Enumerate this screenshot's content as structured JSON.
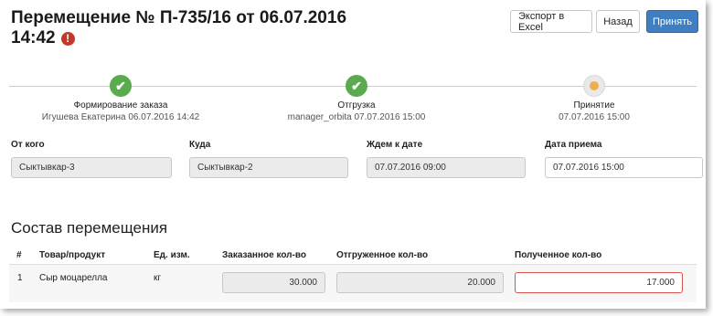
{
  "header": {
    "title_line1": "Перемещение № П-735/16 от 06.07.2016",
    "title_line2": "14:42",
    "warning_glyph": "!"
  },
  "toolbar": {
    "export_label": "Экспорт в Excel",
    "back_label": "Назад",
    "accept_label": "Принять"
  },
  "steps": [
    {
      "label": "Формирование заказа",
      "sub": "Игушева Екатерина 06.07.2016 14:42",
      "status": "done"
    },
    {
      "label": "Отгрузка",
      "sub": "manager_orbita 07.07.2016 15:00",
      "status": "done"
    },
    {
      "label": "Принятие",
      "sub": "07.07.2016 15:00",
      "status": "pending"
    }
  ],
  "form": {
    "from_label": "От кого",
    "from_value": "Сыктывкар-3",
    "to_label": "Куда",
    "to_value": "Сыктывкар-2",
    "expected_label": "Ждем к дате",
    "expected_value": "07.07.2016 09:00",
    "received_label": "Дата приема",
    "received_value": "07.07.2016 15:00"
  },
  "composition": {
    "title": "Состав перемещения",
    "columns": [
      "#",
      "Товар/продукт",
      "Ед. изм.",
      "Заказанное кол-во",
      "Отгруженное кол-во",
      "Полученное кол-во"
    ],
    "rows": [
      {
        "num": "1",
        "product": "Сыр моцарелла",
        "unit": "кг",
        "ordered": "30.000",
        "shipped": "20.000",
        "received": "17.000"
      }
    ]
  },
  "colors": {
    "accent": "#3f7ec0",
    "done": "#5aab4e",
    "pending": "#f0ad4e",
    "error": "#d9534f"
  }
}
